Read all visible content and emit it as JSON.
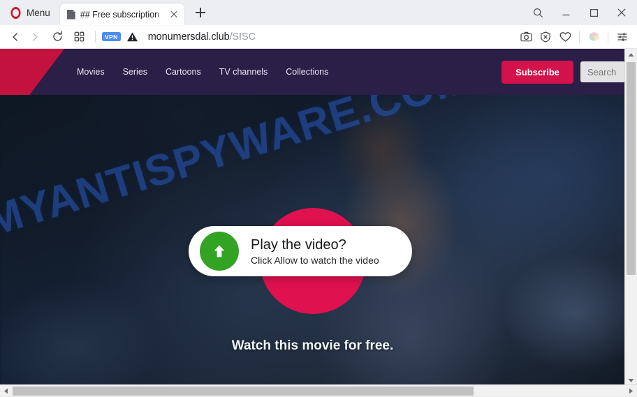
{
  "browser": {
    "menu_label": "Menu",
    "opera_logo_icon": "opera-logo-icon",
    "tab": {
      "title": "## Free subscription",
      "favicon_icon": "page-favicon-icon",
      "close_icon": "close-icon"
    },
    "new_tab_icon": "plus-icon",
    "window_controls": {
      "search_icon": "search-icon",
      "minimize_icon": "minimize-icon",
      "maximize_icon": "maximize-icon",
      "close_icon": "close-icon"
    },
    "toolbar": {
      "back_icon": "chevron-left-icon",
      "forward_icon": "chevron-right-icon",
      "reload_icon": "reload-icon",
      "tab_islands_icon": "grid-squares-icon",
      "vpn_badge": "VPN",
      "security_icon": "warning-triangle-icon",
      "url_domain": "monumersdal.club",
      "url_path": "/SISC",
      "right_icons": [
        {
          "name": "snapshot-camera-icon",
          "label": "camera"
        },
        {
          "name": "ad-blocker-shield-icon",
          "label": "shield"
        },
        {
          "name": "favorites-heart-icon",
          "label": "heart"
        },
        {
          "name": "extensions-cube-icon",
          "label": "cube"
        },
        {
          "name": "easy-setup-sliders-icon",
          "label": "sliders"
        }
      ]
    }
  },
  "site": {
    "logo_shape": "crimson-angled-logo",
    "nav_items": [
      {
        "label": "Movies"
      },
      {
        "label": "Series"
      },
      {
        "label": "Cartoons"
      },
      {
        "label": "TV channels"
      },
      {
        "label": "Collections"
      }
    ],
    "subscribe_label": "Subscribe",
    "search_placeholder": "Search",
    "search_value": "",
    "tagline": "Watch this movie for free.",
    "watermark": "MYANTISPYWARE.COM",
    "play_button_icon": "play-circle-icon",
    "colors": {
      "header_bg": "#2a1f46",
      "logo_crimson": "#c4123f",
      "subscribe_bg": "#d3114a",
      "play_circle": "#e0114f",
      "allow_green": "#33a324",
      "watermark_blue": "#2856b0"
    }
  },
  "prompt": {
    "icon": "upload-arrow-icon",
    "title": "Play the video?",
    "subtitle": "Click Allow to watch the video"
  },
  "scrollbars": {
    "vertical_up_icon": "caret-up-icon",
    "vertical_down_icon": "caret-down-icon",
    "horizontal_left_icon": "caret-left-icon",
    "horizontal_right_icon": "caret-right-icon"
  }
}
